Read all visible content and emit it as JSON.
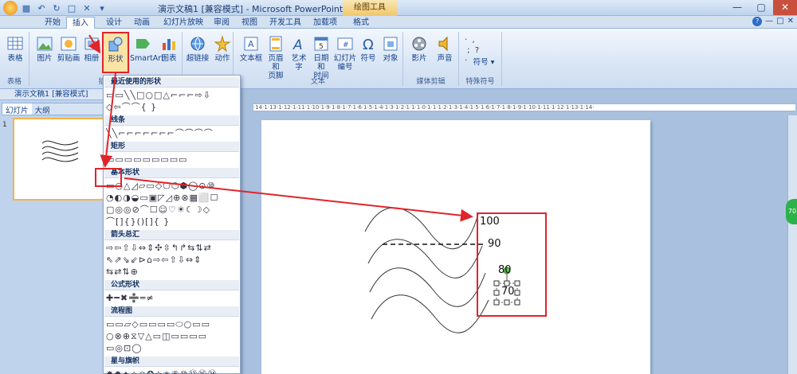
{
  "titlebar": {
    "title": "演示文稿1 [兼容模式] - Microsoft PowerPoint",
    "tool_tab": "绘图工具",
    "qat": [
      "save-icon",
      "undo-icon",
      "redo-icon",
      "print-preview-icon",
      "close-x-icon"
    ],
    "win": [
      "—",
      "▢",
      "✕"
    ]
  },
  "tabs": {
    "home": "开始",
    "insert": "插入",
    "design": "设计",
    "animation": "动画",
    "slideshow": "幻灯片放映",
    "review": "审阅",
    "view": "视图",
    "developer": "开发工具",
    "addins": "加载项",
    "format": "格式"
  },
  "ribbon": {
    "table": "表格",
    "table_group": "表格",
    "picture": "图片",
    "clipart": "剪贴画",
    "album": "相册",
    "shapes": "形状",
    "smartart": "SmartArt",
    "chart": "图表",
    "hyperlink": "超链接",
    "action": "动作",
    "textbox": "文本框",
    "header_footer_1": "页眉和",
    "header_footer_2": "页脚",
    "wordart": "艺术字",
    "datetime_1": "日期和",
    "datetime_2": "时间",
    "slidenum_1": "幻灯片",
    "slidenum_2": "编号",
    "symbol": "符号",
    "object": "对象",
    "text_group": "文本",
    "movie": "影片",
    "sound": "声音",
    "media_group": "媒体剪辑",
    "special_symbols": "符号",
    "special_group": "特殊符号",
    "illustration_group": "插图"
  },
  "leftpane": {
    "tab_slides": "幻灯片",
    "tab_outline": "大纲",
    "slide_number": "1"
  },
  "doc": {
    "title": "演示文稿1 [兼容模式]"
  },
  "ruler": "·14·1·13·1·12·1·11·1·10·1·9·1·8·1·7·1·6·1·5·1·4·1·3·1·2·1·1·1·0·1·1·1·2·1·3·1·4·1·5·1·6·1·7·1·8·1·9·1·10·1·11·1·12·1·13·1·14·",
  "slide": {
    "labels": [
      "100",
      "90",
      "80",
      "70"
    ]
  },
  "green_badge": "70",
  "gallery": {
    "sections": [
      {
        "title": "最近使用的形状",
        "rows": [
          "▭▭╲╲□○□△⌐⌐⌐⇨⇩",
          "◇⇦⌒⌒{ }"
        ]
      },
      {
        "title": "线条",
        "rows": [
          "╲╲⌐⌐⌐⌐⌐⌐⌐⌒⌒⌒⌒"
        ]
      },
      {
        "title": "矩形",
        "rows": [
          "▭▭▭▭▭▭▭▭▭"
        ]
      },
      {
        "title": "基本形状",
        "rows": [
          "▭○△◿▱▭◇⬠⬡⬢◯⊙⑩",
          "◔◐◑◒▭▣◸◿⊕⊗▦⬜☐",
          "▢◎◎⊘⌒☐☺♡☀☾☽◇",
          "⌒[]{}()[]{ }"
        ]
      },
      {
        "title": "箭头总汇",
        "rows": [
          "⇨⇦⇧⇩⇔⇕✣⇳↰↱⇆⇅⇄",
          "⇖⇗⇘⇙⊳⌂⇨⇦⇧⇩⇔⇕",
          "⇆⇄⇅⊕"
        ]
      },
      {
        "title": "公式形状",
        "rows": [
          "✚━✖➗═≠"
        ]
      },
      {
        "title": "流程图",
        "rows": [
          "▭▭▱◇▭▭▭▭⬭○▭▭",
          "○⊗⊕⧖▽△▭◫▭▭▭▭",
          "▭◎⊡◯"
        ]
      },
      {
        "title": "星与旗帜",
        "rows": [
          "✸✹✦✧✩✪✫✬⑧⑩⑫⑯㉔",
          "⌇⌇⌇⌇⌇⌇⌇⌇⌇⌇"
        ]
      }
    ]
  },
  "colors": {
    "highlight": "#e0242b",
    "ribbon_blue": "#15428b",
    "tool_tab": "#f0c76a"
  }
}
